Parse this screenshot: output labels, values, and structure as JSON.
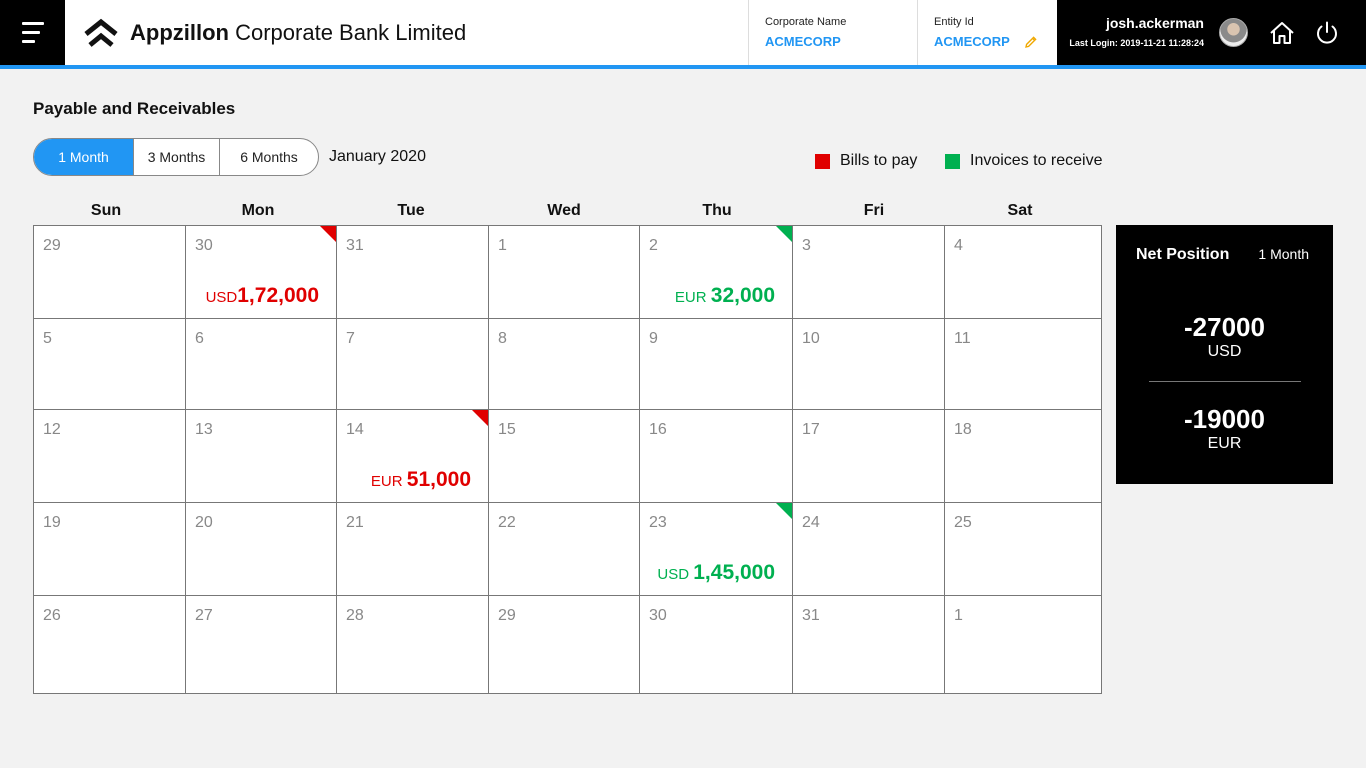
{
  "header": {
    "app_title_bold": "Appzillon",
    "app_title_rest": " Corporate Bank Limited",
    "corporate_label": "Corporate Name",
    "corporate_value": "ACMECORP",
    "entity_label": "Entity Id",
    "entity_value": "ACMECORP",
    "user_name": "josh.ackerman",
    "last_login": "Last Login: 2019-11-21 11:28:24",
    "icons": [
      "menu-icon",
      "logo-icon",
      "edit-pencil-icon",
      "avatar",
      "home-icon",
      "power-icon"
    ]
  },
  "section": {
    "title": "Payable and Receivables",
    "tabs": [
      {
        "label": "1 Month",
        "active": true
      },
      {
        "label": "3 Months",
        "active": false
      },
      {
        "label": "6 Months",
        "active": false
      }
    ],
    "month": "January 2020",
    "legend": [
      {
        "label": "Bills to pay",
        "color": "#e00000"
      },
      {
        "label": "Invoices to receive",
        "color": "#00b050"
      }
    ]
  },
  "calendar": {
    "days": [
      "Sun",
      "Mon",
      "Tue",
      "Wed",
      "Thu",
      "Fri",
      "Sat"
    ],
    "weeks": [
      [
        {
          "d": "29"
        },
        {
          "d": "30",
          "type": "pay",
          "cur": "USD",
          "val": "1,72,000"
        },
        {
          "d": "31"
        },
        {
          "d": "1"
        },
        {
          "d": "2",
          "type": "recv",
          "cur": "EUR ",
          "val": "32,000"
        },
        {
          "d": "3"
        },
        {
          "d": "4"
        }
      ],
      [
        {
          "d": "5"
        },
        {
          "d": "6"
        },
        {
          "d": "7"
        },
        {
          "d": "8"
        },
        {
          "d": "9"
        },
        {
          "d": "10"
        },
        {
          "d": "11"
        }
      ],
      [
        {
          "d": "12"
        },
        {
          "d": "13"
        },
        {
          "d": "14",
          "type": "pay",
          "cur": "EUR ",
          "val": "51,000"
        },
        {
          "d": "15"
        },
        {
          "d": "16"
        },
        {
          "d": "17"
        },
        {
          "d": "18"
        }
      ],
      [
        {
          "d": "19"
        },
        {
          "d": "20"
        },
        {
          "d": "21"
        },
        {
          "d": "22"
        },
        {
          "d": "23",
          "type": "recv",
          "cur": "USD ",
          "val": "1,45,000"
        },
        {
          "d": "24"
        },
        {
          "d": "25"
        }
      ],
      [
        {
          "d": "26"
        },
        {
          "d": "27"
        },
        {
          "d": "28"
        },
        {
          "d": "29"
        },
        {
          "d": "30"
        },
        {
          "d": "31"
        },
        {
          "d": "1"
        }
      ]
    ]
  },
  "net_position": {
    "title": "Net Position",
    "period": "1 Month",
    "entries": [
      {
        "amount": "-27000",
        "currency": "USD"
      },
      {
        "amount": "-19000",
        "currency": "EUR"
      }
    ]
  }
}
